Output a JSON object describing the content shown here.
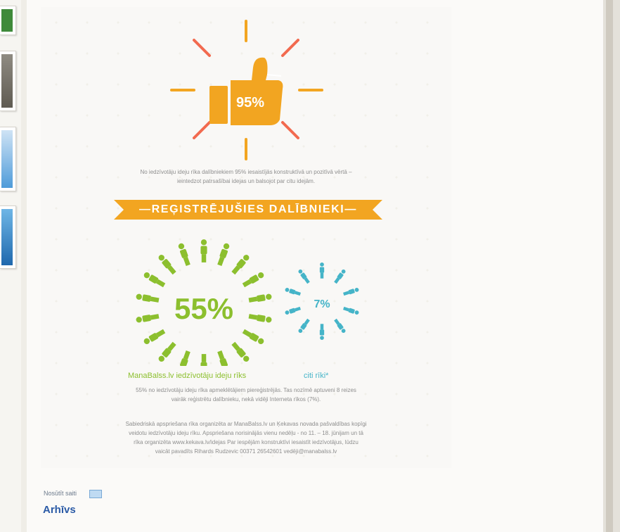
{
  "infographic": {
    "thumbs_percent": "95%",
    "thumbs_caption_line1": "No iedzīvotāju ideju rīka dalībniekiem 95% iesaistījās konstruktīvā un pozitīvā vērtā –",
    "thumbs_caption_line2": "ieintedzot patrsašībai idejas un balsojot par citu idejām.",
    "banner": "—REĢISTRĒJUŠIES DALĪBNIEKI—",
    "big_percent": "55%",
    "small_percent": "7%",
    "label_green": "ManaBalss.lv iedzīvotāju ideju rīks",
    "label_blue": "citi rīki*",
    "para1_line1": "55% no iedzīvotāju ideju rīka apmeklētājiem piereģistrējās. Tas nozīmē aptuveni 8 reizes",
    "para1_line2": "vairāk reģistrētu dalībnieku, nekā vidēji Interneta rīkos (7%).",
    "para2_line1": "Sabiedriskā apspriešana rīka organizēta ar ManaBalss.lv un Ķekavas novada pašvaldības kopīgi",
    "para2_line2": "veidotu iedzīvotāju ideju rīku. Apspriešana norisinājās vienu nedēļu - no 11. – 18. jūnijam un tā",
    "para2_line3": "rīka organizēta www.kekava.lv/idejas Par iespējām konstruktīvi iesaistīt iedzīvotājus, lūdzu",
    "para2_line4": "vaicāt pavadīts Rihards Rudzeviс 00371 26542601 vedēji@manabalss.lv"
  },
  "footer": {
    "send_label": "Nosūtīt saiti",
    "archive_link": "Arhīvs"
  },
  "colors": {
    "orange": "#f2a521",
    "red_ray": "#f26a4f",
    "green": "#8cbf2e",
    "blue": "#45b4c8",
    "link": "#2a5aa6"
  },
  "icons": [
    "thumbs-up-icon",
    "person-icon",
    "mail-icon"
  ]
}
